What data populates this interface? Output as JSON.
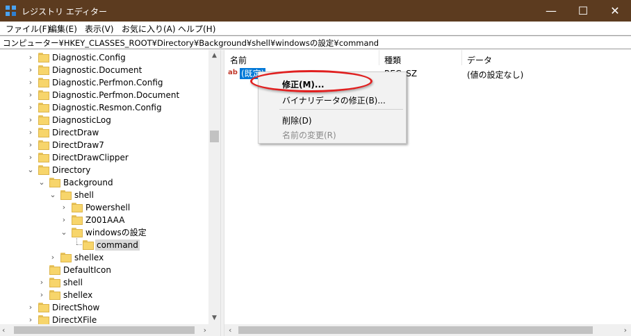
{
  "window": {
    "title": "レジストリ エディター",
    "minimize": "—",
    "maximize": "☐",
    "close": "✕"
  },
  "menu": {
    "items": [
      "ファイル(F)",
      "編集(E)",
      "表示(V)",
      "お気に入り(A)",
      "ヘルプ(H)"
    ]
  },
  "address": {
    "path": "コンピューター¥HKEY_CLASSES_ROOT¥Directory¥Background¥shell¥windowsの設定¥command"
  },
  "tree": {
    "items": [
      {
        "label": "Diagnostic.Config",
        "expander": "›"
      },
      {
        "label": "Diagnostic.Document",
        "expander": "›"
      },
      {
        "label": "Diagnostic.Perfmon.Config",
        "expander": "›"
      },
      {
        "label": "Diagnostic.Perfmon.Document",
        "expander": "›"
      },
      {
        "label": "Diagnostic.Resmon.Config",
        "expander": "›"
      },
      {
        "label": "DiagnosticLog",
        "expander": "›"
      },
      {
        "label": "DirectDraw",
        "expander": "›"
      },
      {
        "label": "DirectDraw7",
        "expander": "›"
      },
      {
        "label": "DirectDrawClipper",
        "expander": "›"
      },
      {
        "label": "Directory",
        "expander": "⌄"
      },
      {
        "label": "Background",
        "expander": "⌄"
      },
      {
        "label": "shell",
        "expander": "⌄"
      },
      {
        "label": "Powershell",
        "expander": "›"
      },
      {
        "label": "Z001AAA",
        "expander": "›"
      },
      {
        "label": "windowsの設定",
        "expander": "⌄"
      },
      {
        "label": "command",
        "expander": ""
      },
      {
        "label": "shellex",
        "expander": "›"
      },
      {
        "label": "DefaultIcon",
        "expander": ""
      },
      {
        "label": "shell",
        "expander": "›"
      },
      {
        "label": "shellex",
        "expander": "›"
      },
      {
        "label": "DirectShow",
        "expander": "›"
      },
      {
        "label": "DirectXFile",
        "expander": "›"
      }
    ]
  },
  "list": {
    "headers": {
      "name": "名前",
      "type": "種類",
      "data": "データ"
    },
    "rows": [
      {
        "icon": "ab",
        "name": "(既定)",
        "type": "REG_SZ",
        "data": "(値の設定なし)"
      }
    ]
  },
  "context_menu": {
    "modify": "修正(M)...",
    "modify_binary": "バイナリデータの修正(B)...",
    "delete": "削除(D)",
    "rename": "名前の変更(R)"
  },
  "scroll": {
    "up": "▲",
    "down": "▼",
    "left": "‹",
    "right": "›"
  },
  "colors": {
    "titlebar": "#5c3b1f",
    "selection": "#0078d7",
    "highlight_ellipse": "#e02020",
    "folder": "#f7d56b"
  }
}
